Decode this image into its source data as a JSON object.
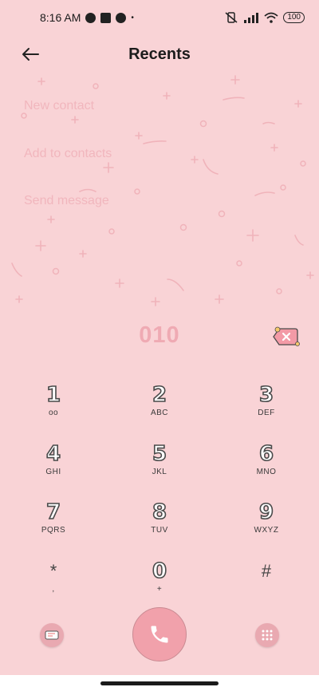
{
  "status_bar": {
    "time": "8:16 AM",
    "battery": "100",
    "icons": [
      "data-saver-icon",
      "stop-icon",
      "data-saver-icon",
      "dot-icon",
      "vibrate-off-icon",
      "signal-icon",
      "wifi-icon",
      "battery-icon"
    ]
  },
  "header": {
    "title": "Recents",
    "back_icon": "arrow-left-icon"
  },
  "actions": {
    "new_contact": "New contact",
    "add_to_contacts": "Add to contacts",
    "send_message": "Send message"
  },
  "dial": {
    "number": "010",
    "delete_icon": "backspace-icon"
  },
  "keypad": {
    "k1": {
      "digit": "1",
      "letters": "oo",
      "icon": "voicemail-icon"
    },
    "k2": {
      "digit": "2",
      "letters": "ABC"
    },
    "k3": {
      "digit": "3",
      "letters": "DEF"
    },
    "k4": {
      "digit": "4",
      "letters": "GHI"
    },
    "k5": {
      "digit": "5",
      "letters": "JKL"
    },
    "k6": {
      "digit": "6",
      "letters": "MNO"
    },
    "k7": {
      "digit": "7",
      "letters": "PQRS"
    },
    "k8": {
      "digit": "8",
      "letters": "TUV"
    },
    "k9": {
      "digit": "9",
      "letters": "WXYZ"
    },
    "kstar": {
      "digit": "*",
      "letters": ","
    },
    "k0": {
      "digit": "0",
      "letters": "+"
    },
    "khash": {
      "digit": "#",
      "letters": ""
    }
  },
  "bottom": {
    "left_icon": "sim-card-icon",
    "call_icon": "phone-icon",
    "right_icon": "dialpad-icon"
  },
  "colors": {
    "background": "#f9d3d6",
    "faded_text": "#f1b6bd",
    "call_button": "#f1a1ab"
  }
}
